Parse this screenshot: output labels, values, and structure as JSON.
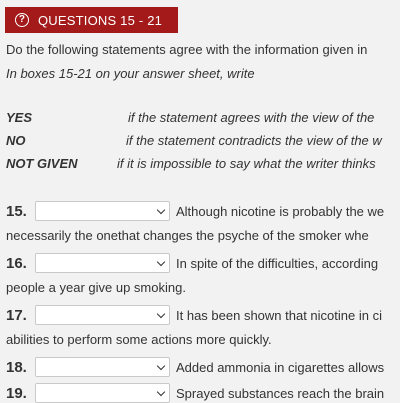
{
  "header": {
    "icon": "question-circle-icon",
    "title": "QUESTIONS 15 - 21",
    "bg_color": "#a41a1a"
  },
  "instructions": {
    "line1": "Do the following statements agree with the information given in",
    "line2": "In boxes 15-21 on your answer sheet, write"
  },
  "legend": [
    {
      "term": "YES",
      "definition": "if the statement agrees with the view of the"
    },
    {
      "term": "NO",
      "definition": "if the statement contradicts the view of the w"
    },
    {
      "term": "NOT GIVEN",
      "definition": "if it is impossible to say what the writer thinks"
    }
  ],
  "questions": [
    {
      "number": "15.",
      "selected": "",
      "text": "Although nicotine is probably the we",
      "continuation": "necessarily the onethat changes the psyche of the smoker whe"
    },
    {
      "number": "16.",
      "selected": "",
      "text": "In spite of the difficulties, according",
      "continuation": "people a year give up smoking."
    },
    {
      "number": "17.",
      "selected": "",
      "text": "It has been shown that nicotine in ci",
      "continuation": "abilities to perform some actions more quickly."
    },
    {
      "number": "18.",
      "selected": "",
      "text": "Added ammonia in cigarettes allows",
      "continuation": ""
    },
    {
      "number": "19.",
      "selected": "",
      "text": "Sprayed substances reach the brain",
      "continuation": ""
    }
  ]
}
